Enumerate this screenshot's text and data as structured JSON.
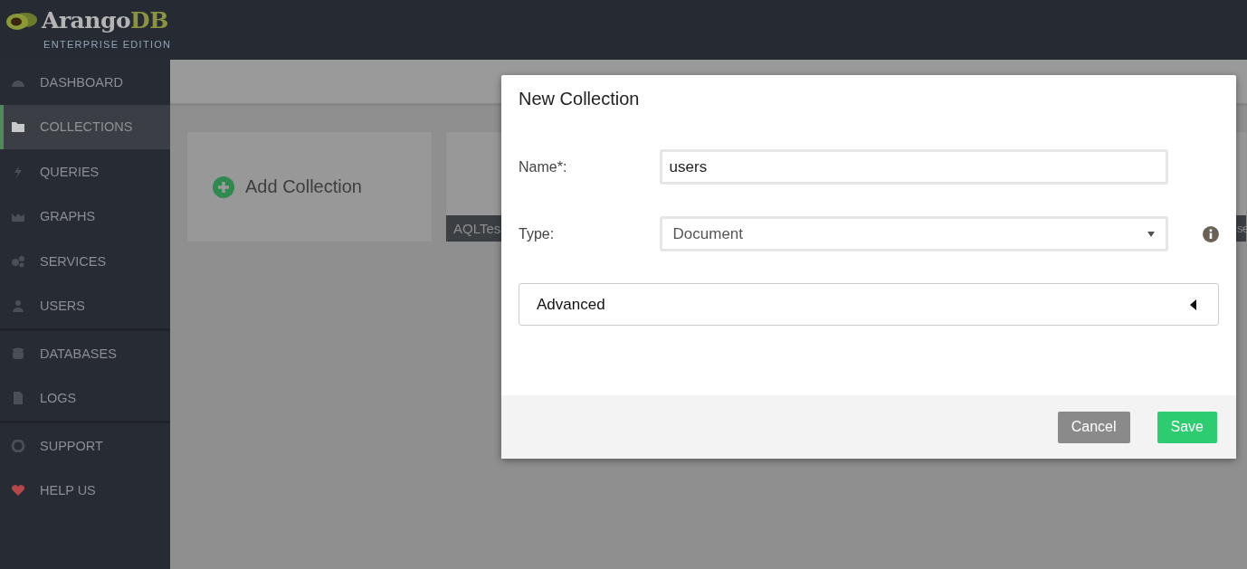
{
  "logo": {
    "name": "Arango",
    "accent": "DB",
    "edition": "ENTERPRISE EDITION"
  },
  "sidebar": {
    "sections": [
      {
        "items": [
          {
            "label": "DASHBOARD",
            "selected": false
          },
          {
            "label": "COLLECTIONS",
            "selected": true
          },
          {
            "label": "QUERIES",
            "selected": false
          },
          {
            "label": "GRAPHS",
            "selected": false
          },
          {
            "label": "SERVICES",
            "selected": false
          },
          {
            "label": "USERS",
            "selected": false
          }
        ]
      },
      {
        "items": [
          {
            "label": "DATABASES",
            "selected": false
          },
          {
            "label": "LOGS",
            "selected": false
          }
        ]
      },
      {
        "items": [
          {
            "label": "SUPPORT",
            "selected": false
          },
          {
            "label": "HELP US",
            "selected": false
          }
        ]
      }
    ]
  },
  "cards": [
    {
      "kind": "add",
      "label": "Add Collection"
    },
    {
      "kind": "collection",
      "label": "AQLTes"
    },
    {
      "kind": "collection",
      "label": "se"
    }
  ],
  "modal": {
    "title": "New Collection",
    "fields": [
      {
        "kind": "input",
        "label": "Name*:",
        "value": "users"
      },
      {
        "kind": "select",
        "label": "Type:",
        "value": "Document"
      }
    ],
    "advanced": {
      "label": "Advanced",
      "expanded": false
    },
    "buttons": [
      {
        "kind": "cancel",
        "label": "Cancel"
      },
      {
        "kind": "save",
        "label": "Save"
      }
    ]
  }
}
